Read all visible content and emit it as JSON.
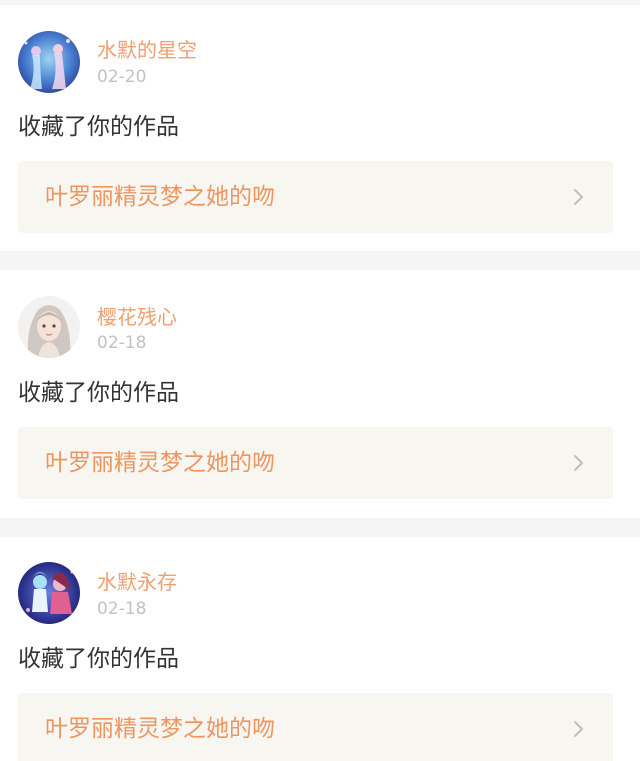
{
  "notifications": [
    {
      "username": "水默的星空",
      "date": "02-20",
      "action": "收藏了你的作品",
      "work_title": "叶罗丽精灵梦之她的吻",
      "avatar_icon": "fairy-avatar-icon"
    },
    {
      "username": "樱花残心",
      "date": "02-18",
      "action": "收藏了你的作品",
      "work_title": "叶罗丽精灵梦之她的吻",
      "avatar_icon": "doll-avatar-icon"
    },
    {
      "username": "水默永存",
      "date": "02-18",
      "action": "收藏了你的作品",
      "work_title": "叶罗丽精灵梦之她的吻",
      "avatar_icon": "dancing-couple-avatar-icon"
    }
  ],
  "colors": {
    "username": "#f0a070",
    "date": "#c2c2c2",
    "work_title": "#ef9560",
    "work_bg": "#f7f6f1",
    "divider_bg": "#f5f5f5"
  }
}
